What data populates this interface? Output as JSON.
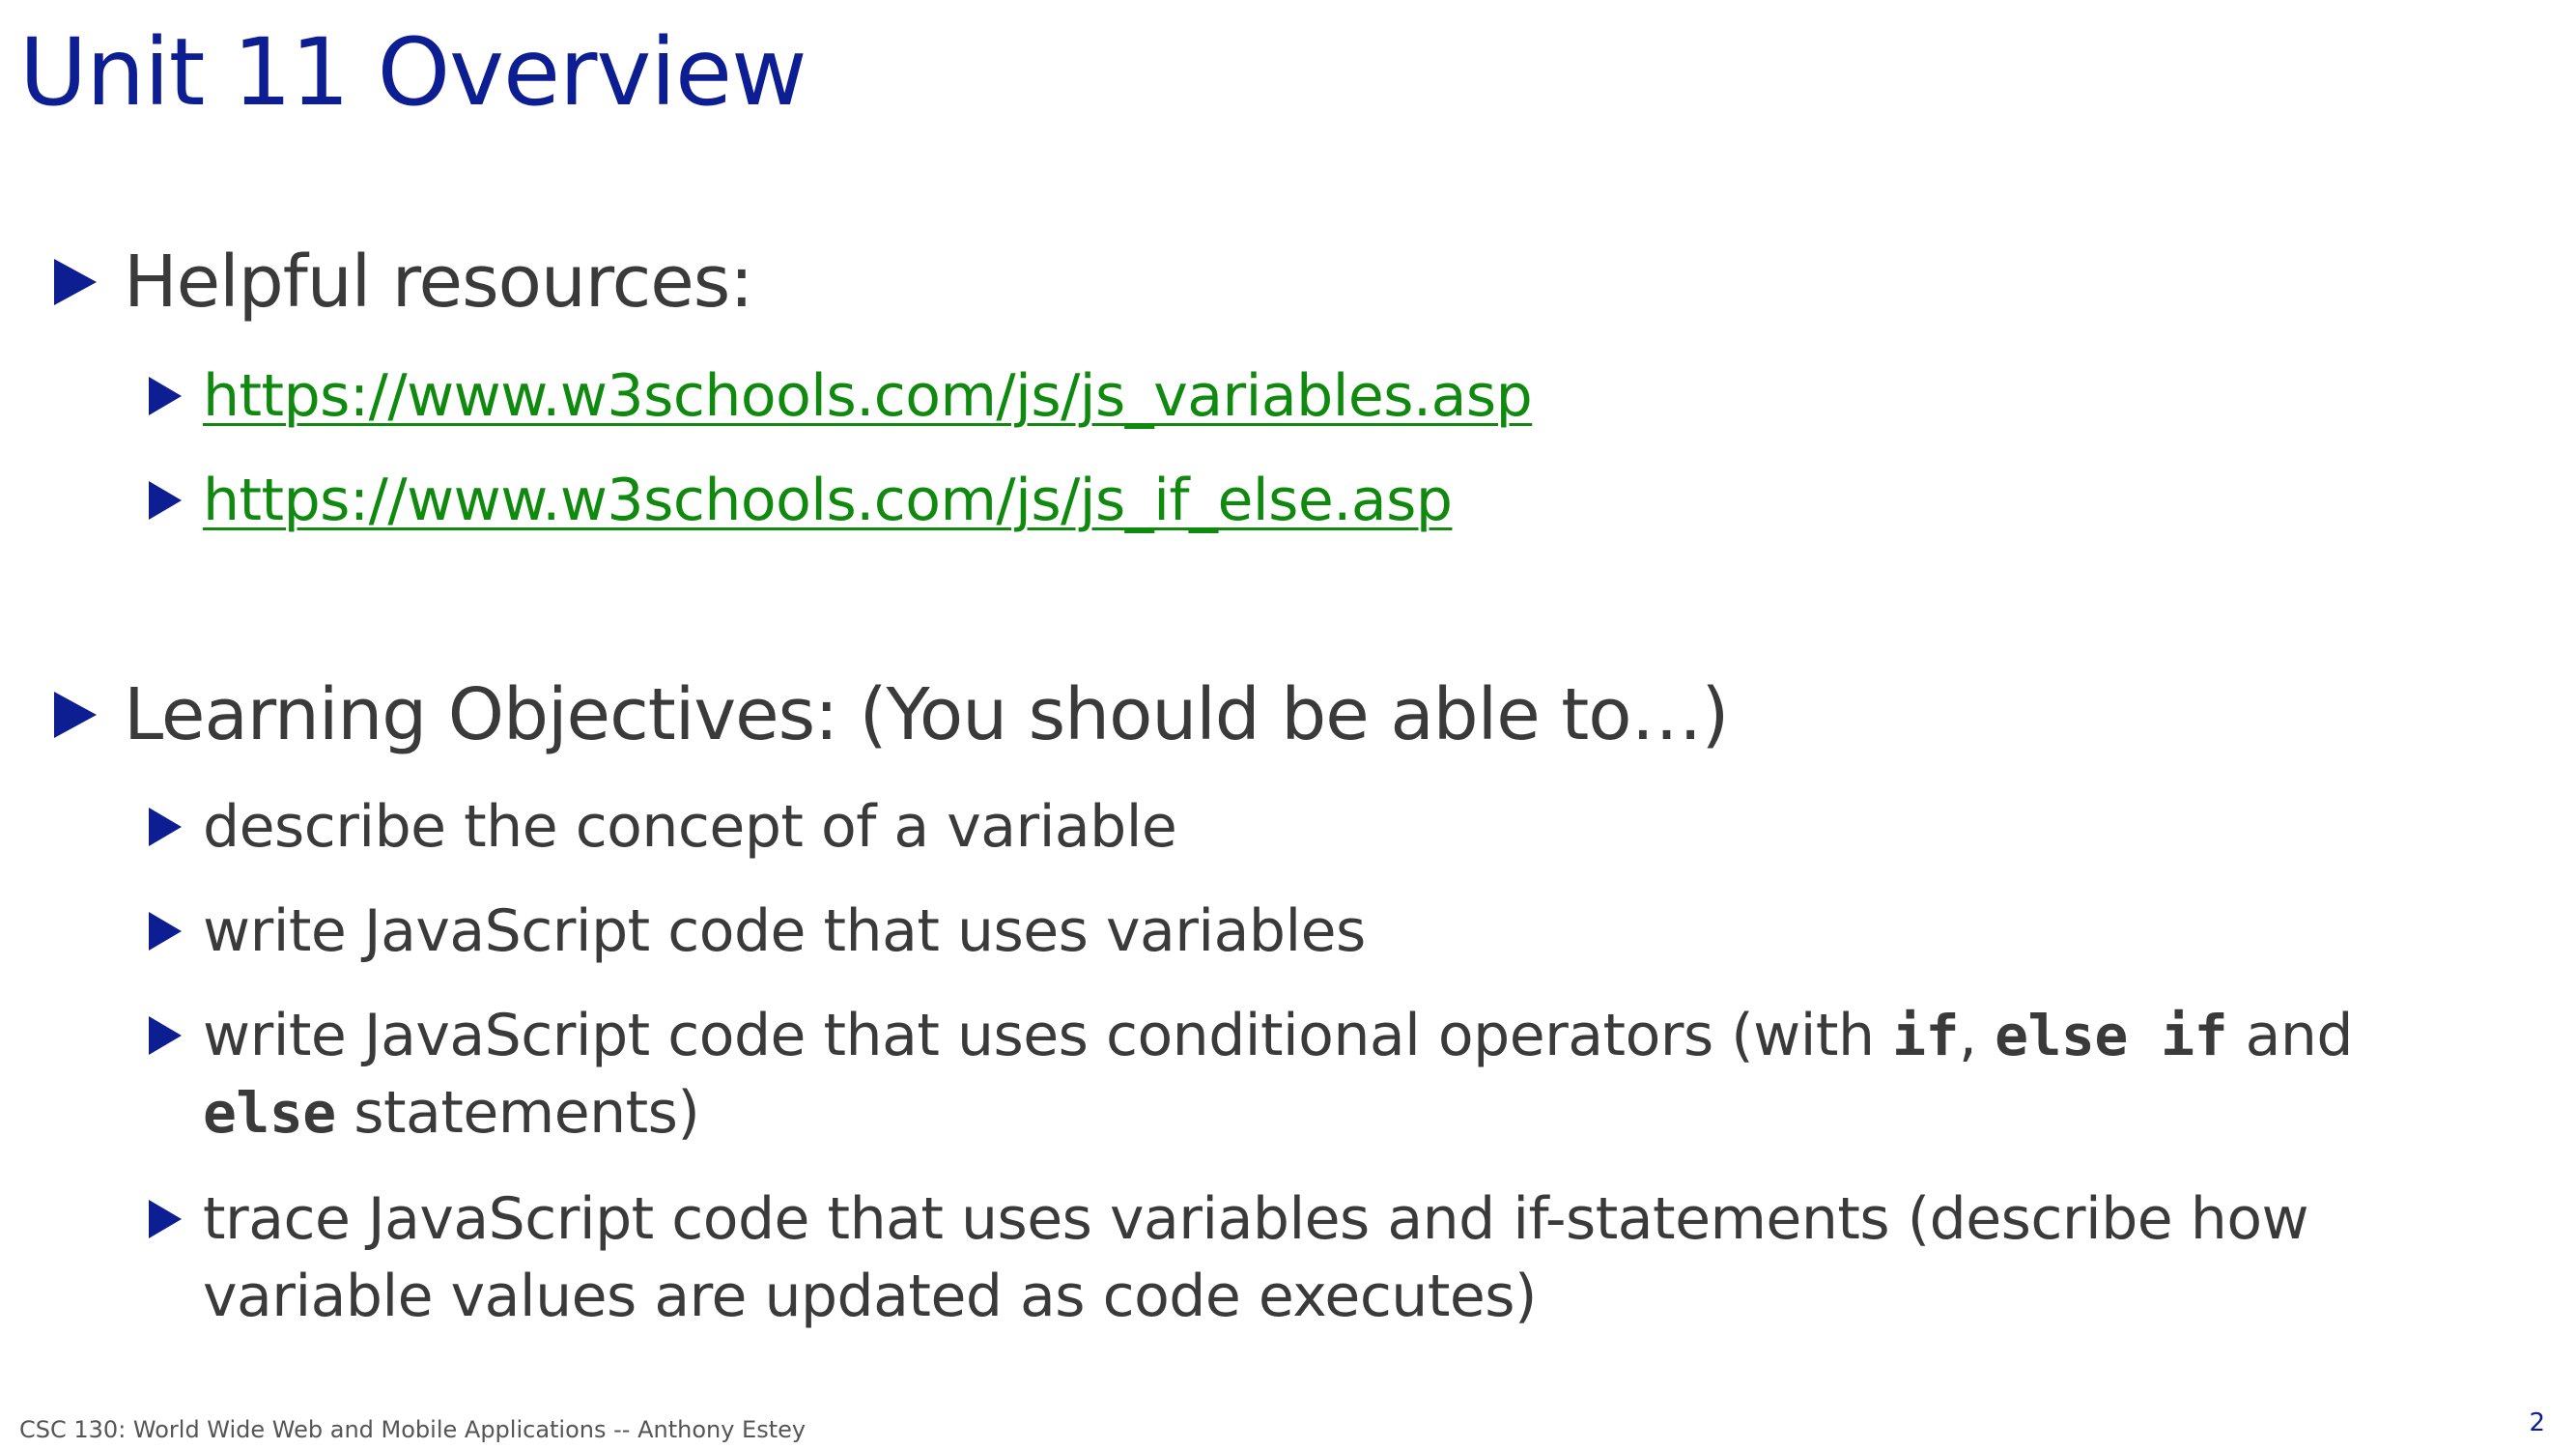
{
  "slide": {
    "title": "Unit 11 Overview",
    "resources": {
      "heading": "Helpful resources:",
      "links": [
        "https://www.w3schools.com/js/js_variables.asp",
        "https://www.w3schools.com/js/js_if_else.asp"
      ]
    },
    "objectives": {
      "heading": "Learning Objectives: (You should be able to…)",
      "items": [
        {
          "text": "describe the concept of a variable"
        },
        {
          "text": "write JavaScript code that uses variables"
        },
        {
          "part1": "write JavaScript code that uses conditional operators (with ",
          "code1": "if",
          "part2": ", ",
          "code2": "else if",
          "part3": " and ",
          "code3": "else",
          "part4": " statements)"
        },
        {
          "text": "trace JavaScript code that uses variables and if-statements (describe how variable values are updated as code executes)"
        }
      ]
    },
    "footer": "CSC 130: World Wide Web and Mobile Applications -- Anthony Estey",
    "page_number": "2"
  },
  "colors": {
    "title": "#0d1d92",
    "bullet": "#0d1d92",
    "link": "#0f8a0f",
    "body_text": "#3a3a3a"
  },
  "icons": {
    "bullet": "triangle-right-icon"
  }
}
